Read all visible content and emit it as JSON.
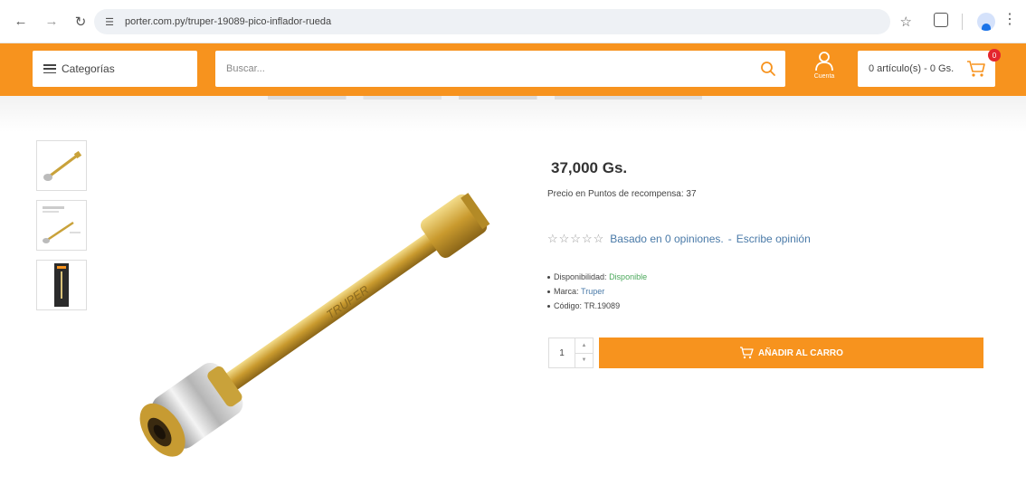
{
  "browser": {
    "url": "porter.com.py/truper-19089-pico-inflador-rueda",
    "icons": [
      "back-icon",
      "forward-icon",
      "reload-icon",
      "site-settings-icon",
      "bookmark-star-icon",
      "extensions-icon",
      "profile-icon",
      "menu-icon"
    ]
  },
  "header": {
    "categories_label": "Categorías",
    "search_placeholder": "Buscar...",
    "account_label": "Cuenta",
    "cart_summary": "0 artículo(s) - 0 Gs.",
    "cart_count": "0",
    "accent_color": "#f7931e"
  },
  "product": {
    "price": "37,000 Gs.",
    "points": "Precio en Puntos de recompensa: 37",
    "stars": "☆☆☆☆☆",
    "rating_value": 0,
    "reviews_link": "Basado en 0 opiniones.",
    "separator": "-",
    "write_review": "Escribe opinión",
    "specs": {
      "availability_label": "Disponibilidad:",
      "availability_value": "Disponible",
      "brand_label": "Marca:",
      "brand_value": "Truper",
      "code_label": "Código:",
      "code_value": "TR.19089"
    },
    "quantity": "1",
    "add_to_cart": "AÑADIR AL CARRO",
    "image_text": "TRUPER"
  }
}
